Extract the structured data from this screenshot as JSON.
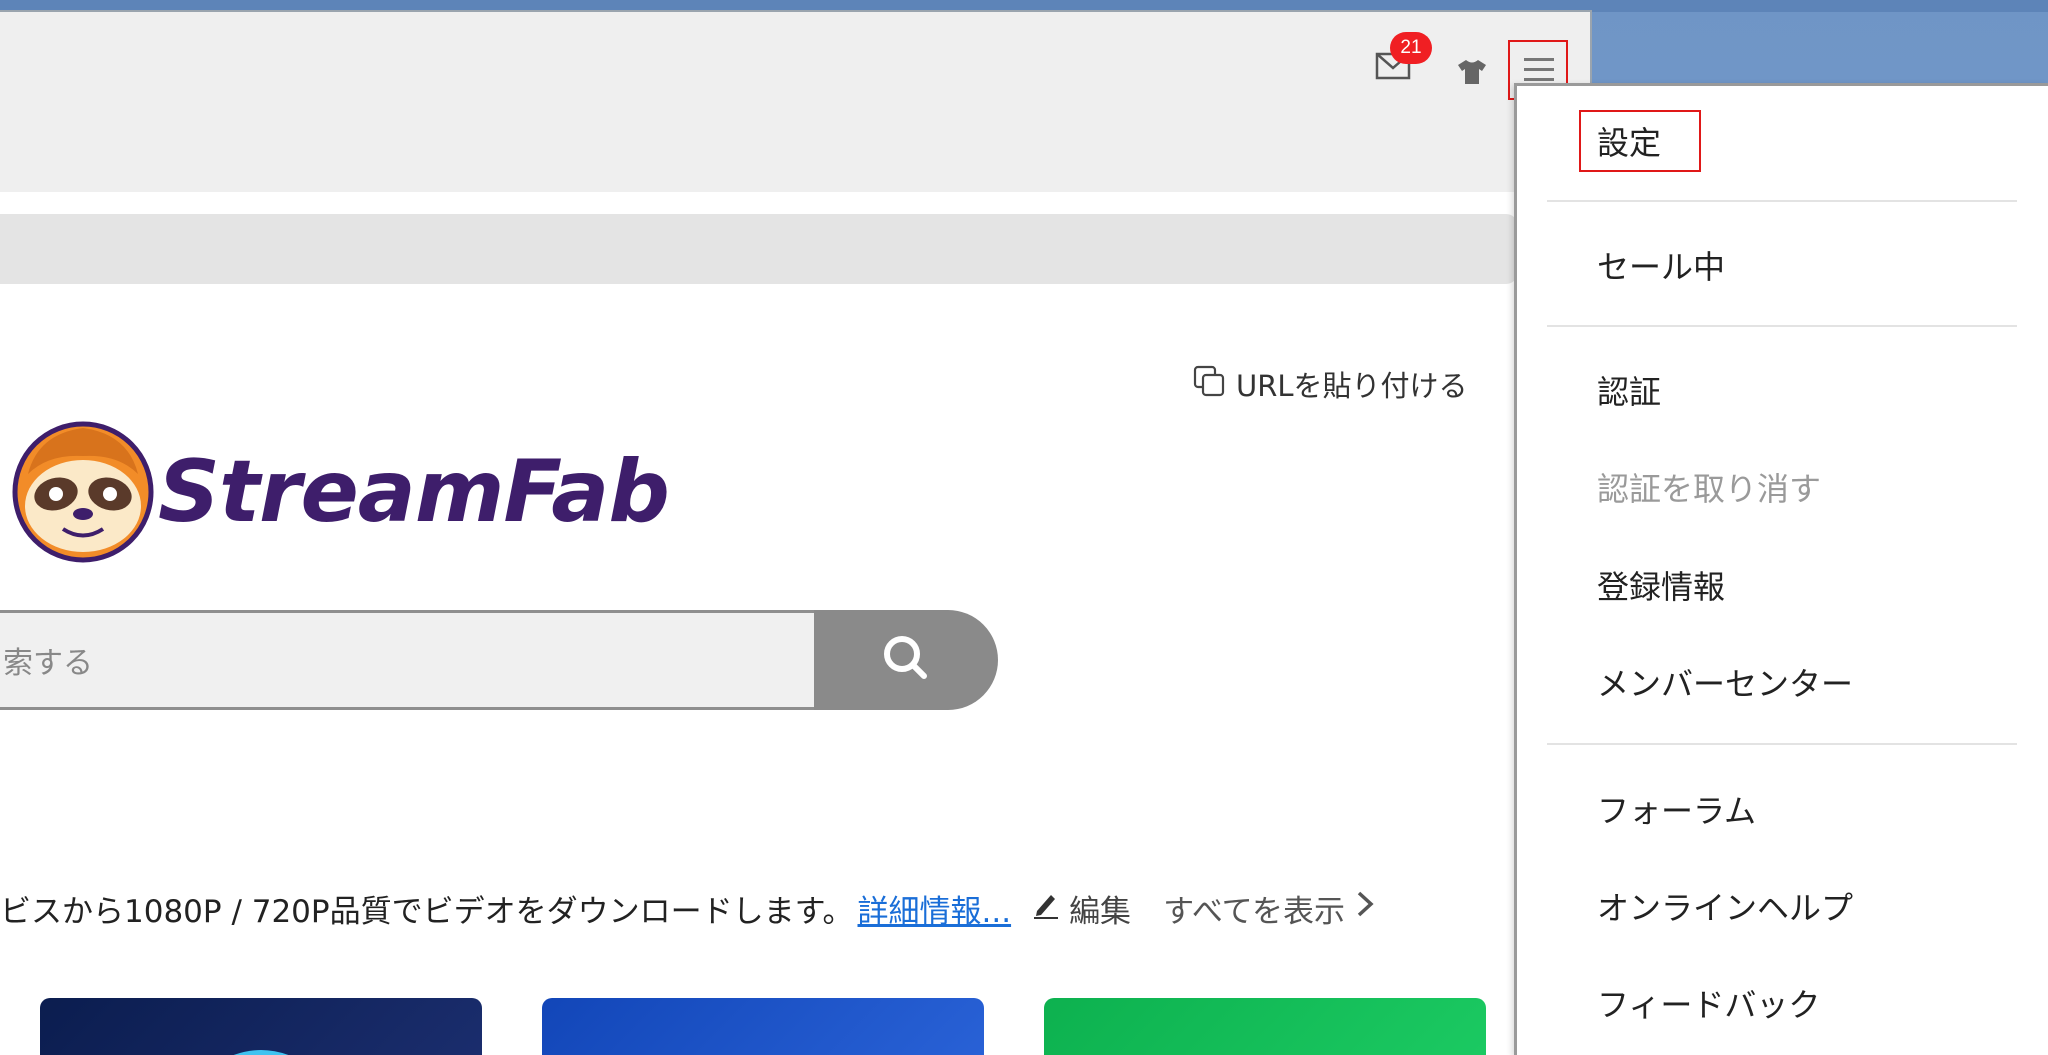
{
  "toolbar": {
    "mail_badge": "21",
    "icons": [
      "mail-icon",
      "shirt-icon",
      "hamburger-menu-icon"
    ]
  },
  "main": {
    "paste_url_label": "URLを貼り付ける",
    "logo_text": "StreamFab",
    "search_placeholder": "索する",
    "description": "ビスから1080P / 720P品質でビデオをダウンロードします。",
    "more_info_link": "詳細情報...",
    "edit_label": "編集",
    "show_all_label": "すべてを表示"
  },
  "menu": {
    "settings": "設定",
    "sale": "セール中",
    "activate": "認証",
    "deactivate": "認証を取り消す",
    "registration_info": "登録情報",
    "member_center": "メンバーセンター",
    "forum": "フォーラム",
    "online_help": "オンラインヘルプ",
    "feedback": "フィードバック"
  },
  "colors": {
    "badge": "#f01f23",
    "highlight_border": "#e01818",
    "link": "#1a6ed8",
    "logo_purple": "#3e1e6b"
  }
}
